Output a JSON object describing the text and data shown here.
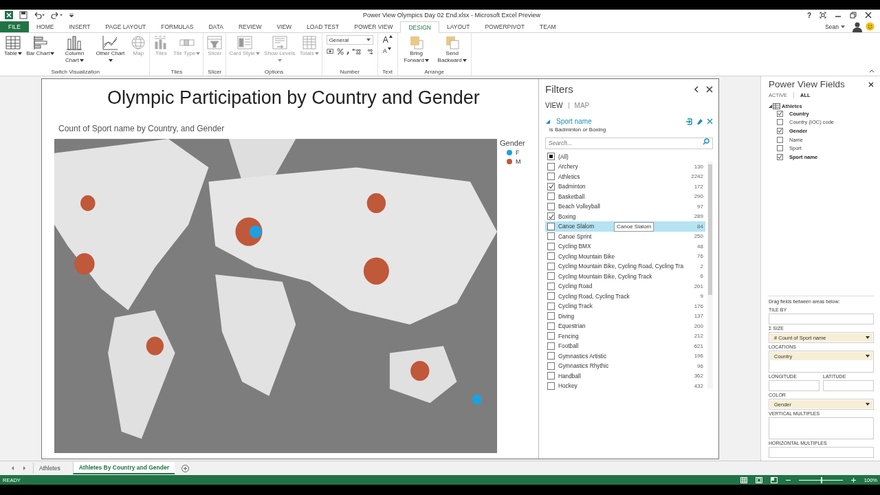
{
  "title_bar": {
    "title": "Power View Olympics Day 02 End.xlsx - Microsoft Excel Preview",
    "user": "Sean",
    "help": "?"
  },
  "ribbon_tabs": [
    {
      "label": "FILE",
      "kind": "file",
      "selected": false
    },
    {
      "label": "HOME",
      "kind": "tab",
      "selected": false
    },
    {
      "label": "INSERT",
      "kind": "tab",
      "selected": false
    },
    {
      "label": "PAGE LAYOUT",
      "kind": "tab",
      "selected": false
    },
    {
      "label": "FORMULAS",
      "kind": "tab",
      "selected": false
    },
    {
      "label": "DATA",
      "kind": "tab",
      "selected": false
    },
    {
      "label": "REVIEW",
      "kind": "tab",
      "selected": false
    },
    {
      "label": "VIEW",
      "kind": "tab",
      "selected": false
    },
    {
      "label": "LOAD TEST",
      "kind": "tab",
      "selected": false
    },
    {
      "label": "POWER VIEW",
      "kind": "tab",
      "selected": false
    },
    {
      "label": "DESIGN",
      "kind": "tab",
      "selected": true
    },
    {
      "label": "LAYOUT",
      "kind": "tab",
      "selected": false
    },
    {
      "label": "POWERPIVOT",
      "kind": "tab",
      "selected": false
    },
    {
      "label": "TEAM",
      "kind": "tab",
      "selected": false
    }
  ],
  "ribbon": {
    "groups": [
      {
        "label": "Switch Visualization",
        "kind": "buttons",
        "items": [
          {
            "label": "Table",
            "dropdown": true,
            "disabled": false
          },
          {
            "label": "Bar Chart",
            "dropdown": true,
            "disabled": false
          },
          {
            "label": "Column Chart",
            "dropdown": true,
            "disabled": false
          },
          {
            "label": "Other Chart",
            "dropdown": true,
            "disabled": false
          },
          {
            "label": "Map",
            "dropdown": false,
            "disabled": true
          }
        ]
      },
      {
        "label": "Tiles",
        "kind": "buttons",
        "items": [
          {
            "label": "Tiles",
            "dropdown": false,
            "disabled": true
          },
          {
            "label": "Tile Type",
            "dropdown": true,
            "disabled": true
          }
        ]
      },
      {
        "label": "Slicer",
        "kind": "buttons",
        "items": [
          {
            "label": "Slicer",
            "dropdown": false,
            "disabled": true
          }
        ]
      },
      {
        "label": "Options",
        "kind": "buttons",
        "items": [
          {
            "label": "Card Style",
            "dropdown": true,
            "disabled": true
          },
          {
            "label": "Show Levels",
            "dropdown": true,
            "disabled": true
          },
          {
            "label": "Totals",
            "dropdown": true,
            "disabled": true
          }
        ]
      },
      {
        "label": "Number",
        "kind": "number",
        "format": "General"
      },
      {
        "label": "Text",
        "kind": "font",
        "items": [
          {
            "label": "A",
            "kind": "grow"
          },
          {
            "label": "A",
            "kind": "shrink"
          }
        ]
      },
      {
        "label": "Arrange",
        "kind": "buttons",
        "items": [
          {
            "label": "Bring Forward",
            "dropdown": true,
            "disabled": false
          },
          {
            "label": "Send Backward",
            "dropdown": true,
            "disabled": false
          }
        ]
      }
    ]
  },
  "view": {
    "title": "Olympic Participation by Country and Gender",
    "chart_title": "Count of Sport name by Country, and Gender",
    "legend": {
      "title": "Gender",
      "items": [
        {
          "label": "F",
          "color": "#1ba1e2"
        },
        {
          "label": "M",
          "color": "#c0583a"
        }
      ]
    }
  },
  "filters": {
    "title": "Filters",
    "tabs": [
      {
        "label": "VIEW",
        "selected": true
      },
      {
        "label": "MAP",
        "selected": false
      }
    ],
    "field": {
      "name": "Sport name",
      "summary": "is Badminton or Boxing",
      "expanded": true
    },
    "search": {
      "placeholder": "Search..."
    },
    "all_option": {
      "label": "(All)",
      "partial": true
    },
    "items": [
      {
        "label": "Archery",
        "count": "130",
        "checked": false,
        "highlighted": false
      },
      {
        "label": "Athletics",
        "count": "2242",
        "checked": false,
        "highlighted": false
      },
      {
        "label": "Badminton",
        "count": "172",
        "checked": true,
        "highlighted": false
      },
      {
        "label": "Basketball",
        "count": "290",
        "checked": false,
        "highlighted": false
      },
      {
        "label": "Beach Volleyball",
        "count": "97",
        "checked": false,
        "highlighted": false
      },
      {
        "label": "Boxing",
        "count": "289",
        "checked": true,
        "highlighted": false
      },
      {
        "label": "Canoe Slalom",
        "count": "84",
        "checked": false,
        "highlighted": true
      },
      {
        "label": "Canoe Sprint",
        "count": "250",
        "checked": false,
        "highlighted": false
      },
      {
        "label": "Cycling BMX",
        "count": "48",
        "checked": false,
        "highlighted": false
      },
      {
        "label": "Cycling Mountain Bike",
        "count": "76",
        "checked": false,
        "highlighted": false
      },
      {
        "label": "Cycling Mountain Bike, Cycling Road, Cycling Tra",
        "count": "2",
        "checked": false,
        "highlighted": false
      },
      {
        "label": "Cycling Mountain Bike, Cycling Track",
        "count": "6",
        "checked": false,
        "highlighted": false
      },
      {
        "label": "Cycling Road",
        "count": "201",
        "checked": false,
        "highlighted": false
      },
      {
        "label": "Cycling Road, Cycling Track",
        "count": "9",
        "checked": false,
        "highlighted": false
      },
      {
        "label": "Cycling Track",
        "count": "176",
        "checked": false,
        "highlighted": false
      },
      {
        "label": "Diving",
        "count": "137",
        "checked": false,
        "highlighted": false
      },
      {
        "label": "Equestrian",
        "count": "200",
        "checked": false,
        "highlighted": false
      },
      {
        "label": "Fencing",
        "count": "212",
        "checked": false,
        "highlighted": false
      },
      {
        "label": "Football",
        "count": "621",
        "checked": false,
        "highlighted": false
      },
      {
        "label": "Gymnastics Artistic",
        "count": "196",
        "checked": false,
        "highlighted": false
      },
      {
        "label": "Gymnastics Rhythic",
        "count": "96",
        "checked": false,
        "highlighted": false
      },
      {
        "label": "Handball",
        "count": "362",
        "checked": false,
        "highlighted": false
      },
      {
        "label": "Hockey",
        "count": "432",
        "checked": false,
        "highlighted": false
      }
    ],
    "tooltip": "Canoe Slalom"
  },
  "fields_pane": {
    "title": "Power View Fields",
    "tabs": [
      {
        "label": "ACTIVE",
        "selected": false
      },
      {
        "label": "ALL",
        "selected": true
      }
    ],
    "table": {
      "name": "Athletes",
      "expanded": true,
      "fields": [
        {
          "label": "Country",
          "checked": true
        },
        {
          "label": "Country (IOC) code",
          "checked": false
        },
        {
          "label": "Gender",
          "checked": true
        },
        {
          "label": "Name",
          "checked": false
        },
        {
          "label": "Sport",
          "checked": false
        },
        {
          "label": "Sport name",
          "checked": true
        }
      ]
    },
    "hint": "Drag fields between areas below:",
    "areas": [
      {
        "label": "TILE BY",
        "kind": "line"
      },
      {
        "label": "Σ SIZE",
        "kind": "line",
        "value": "# Count of Sport name"
      },
      {
        "label": "LOCATIONS",
        "kind": "box",
        "value": "Country"
      },
      {
        "label": "LONGITUDE",
        "kind": "half"
      },
      {
        "label": "LATITUDE",
        "kind": "half"
      },
      {
        "label": "COLOR",
        "kind": "line",
        "value": "Gender"
      },
      {
        "label": "VERTICAL MULTIPLES",
        "kind": "box"
      },
      {
        "label": "HORIZONTAL MULTIPLES",
        "kind": "line"
      }
    ]
  },
  "sheet_tabs": [
    {
      "label": "Athletes",
      "selected": false
    },
    {
      "label": "Athletes By Country and Gender",
      "selected": true
    }
  ],
  "status_bar": {
    "status": "READY",
    "zoom": "100%",
    "zoom_slider": {
      "level": 0.5
    }
  }
}
